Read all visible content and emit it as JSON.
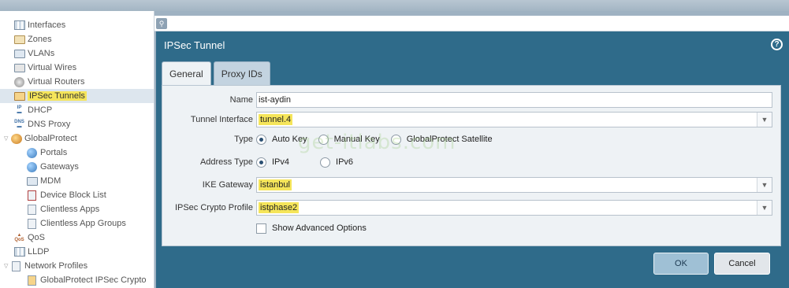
{
  "sidebar": {
    "items": [
      {
        "label": "Interfaces",
        "icon": "interfaces-icon"
      },
      {
        "label": "Zones",
        "icon": "zones-icon"
      },
      {
        "label": "VLANs",
        "icon": "vlans-icon"
      },
      {
        "label": "Virtual Wires",
        "icon": "virtual-wires-icon"
      },
      {
        "label": "Virtual Routers",
        "icon": "virtual-routers-icon"
      },
      {
        "label": "IPSec Tunnels",
        "icon": "ipsec-tunnels-icon",
        "selected": true
      },
      {
        "label": "DHCP",
        "icon": "dhcp-icon"
      },
      {
        "label": "DNS Proxy",
        "icon": "dns-proxy-icon"
      },
      {
        "label": "GlobalProtect",
        "icon": "globalprotect-icon"
      },
      {
        "label": "Portals",
        "icon": "portals-icon"
      },
      {
        "label": "Gateways",
        "icon": "gateways-icon"
      },
      {
        "label": "MDM",
        "icon": "mdm-icon"
      },
      {
        "label": "Device Block List",
        "icon": "device-block-list-icon"
      },
      {
        "label": "Clientless Apps",
        "icon": "clientless-apps-icon"
      },
      {
        "label": "Clientless App Groups",
        "icon": "clientless-app-groups-icon"
      },
      {
        "label": "QoS",
        "icon": "qos-icon"
      },
      {
        "label": "LLDP",
        "icon": "lldp-icon"
      },
      {
        "label": "Network Profiles",
        "icon": "network-profiles-icon"
      },
      {
        "label": "GlobalProtect IPSec Crypto",
        "icon": "globalprotect-ipsec-crypto-icon"
      }
    ]
  },
  "dialog": {
    "title": "IPSec Tunnel",
    "help_icon": "help-icon",
    "tabs": [
      {
        "label": "General",
        "active": true
      },
      {
        "label": "Proxy IDs",
        "active": false
      }
    ],
    "form": {
      "name_label": "Name",
      "name_value": "ist-aydin",
      "tunnel_interface_label": "Tunnel Interface",
      "tunnel_interface_value": "tunnel.4",
      "type_label": "Type",
      "type_options": [
        "Auto Key",
        "Manual Key",
        "GlobalProtect Satellite"
      ],
      "type_selected": "Auto Key",
      "address_type_label": "Address Type",
      "address_type_options": [
        "IPv4",
        "IPv6"
      ],
      "address_type_selected": "IPv4",
      "ike_gateway_label": "IKE Gateway",
      "ike_gateway_value": "istanbul",
      "ipsec_crypto_profile_label": "IPSec Crypto Profile",
      "ipsec_crypto_profile_value": "istphase2",
      "show_advanced_label": "Show Advanced Options",
      "show_advanced_checked": false
    },
    "buttons": {
      "ok": "OK",
      "cancel": "Cancel"
    }
  },
  "watermark": "get-itlabs.com",
  "colors": {
    "dialog_bg": "#2f6b8a",
    "highlight": "#f5e55a",
    "panel_bg": "#eef2f5"
  }
}
